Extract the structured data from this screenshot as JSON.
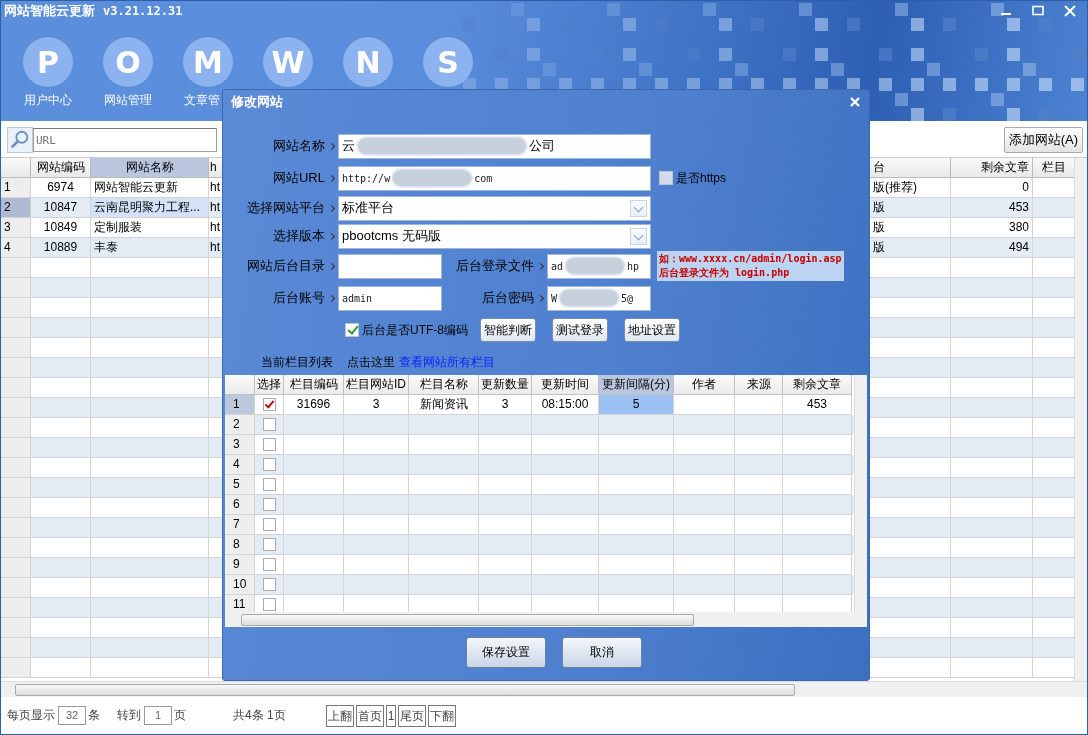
{
  "window": {
    "title": "网站智能云更新",
    "version": "v3.21.12.31"
  },
  "toolbar": [
    {
      "letter": "P",
      "label": "用户中心"
    },
    {
      "letter": "O",
      "label": "网站管理"
    },
    {
      "letter": "M",
      "label": "文章管"
    },
    {
      "letter": "W"
    },
    {
      "letter": "N"
    },
    {
      "letter": "S"
    }
  ],
  "search": {
    "placeholder": "URL"
  },
  "add_button": "添加网站(A)",
  "sites_table": {
    "columns": [
      "网站编码",
      "网站名称",
      "h",
      "台",
      "剩余文章",
      "栏目"
    ],
    "rows": [
      {
        "number": "1",
        "selected": false,
        "cells": [
          "6974",
          "网站智能云更新",
          "ht",
          "版(推荐)",
          "0",
          null
        ]
      },
      {
        "number": "2",
        "selected": true,
        "cells": [
          "10847",
          "云南昆明聚力工程...",
          "ht",
          "版",
          "453",
          null
        ]
      },
      {
        "number": "3",
        "selected": false,
        "cells": [
          "10849",
          "定制服装",
          "ht",
          "版",
          "380",
          null
        ]
      },
      {
        "number": "4",
        "selected": false,
        "cells": [
          "10889",
          "丰泰",
          "ht",
          "版",
          "494",
          null
        ]
      }
    ]
  },
  "pager": {
    "per_page_label": "每页显示",
    "per_page": "32",
    "per_page_unit": "条",
    "goto_label": "转到",
    "goto_page": "1",
    "goto_unit": "页",
    "summary": "共4条 1页",
    "buttons": [
      "上翻",
      "首页",
      "1",
      "尾页",
      "下翻"
    ]
  },
  "dialog": {
    "title": "修改网站",
    "site_name": {
      "label": "网站名称",
      "value_parts": [
        "云",
        "公司"
      ]
    },
    "site_url": {
      "label": "网站URL",
      "value_parts": [
        "http://w",
        "com"
      ]
    },
    "https": {
      "label": "是否https",
      "checked": false
    },
    "platform": {
      "label": "选择网站平台",
      "value": "标准平台"
    },
    "version": {
      "label": "选择版本",
      "value": "pbootcms 无码版"
    },
    "admin_dir": {
      "label": "网站后台目录"
    },
    "login_file": {
      "label": "后台登录文件",
      "value_parts": [
        "ad",
        "hp"
      ]
    },
    "hint": [
      "如：www.xxxx.cn/admin/login.asp",
      "后台登录文件为 login.php"
    ],
    "account": {
      "label": "后台账号",
      "value": "admin"
    },
    "password": {
      "label": "后台密码",
      "value_parts": [
        "W",
        "5@"
      ]
    },
    "utf8": {
      "label": "后台是否UTF-8编码",
      "checked": true
    },
    "action_buttons": [
      "智能判断",
      "测试登录",
      "地址设置"
    ],
    "list_label": "当前栏目列表",
    "click_here": "点击这里",
    "link": "查看网站所有栏目",
    "grid": {
      "columns": [
        {
          "label": "选择",
          "selected": false
        },
        {
          "label": "栏目编码",
          "selected": false
        },
        {
          "label": "栏目网站ID",
          "selected": false
        },
        {
          "label": "栏目名称",
          "selected": false
        },
        {
          "label": "更新数量",
          "selected": false
        },
        {
          "label": "更新时间",
          "selected": false
        },
        {
          "label": "更新间隔(分)",
          "selected": true
        },
        {
          "label": "作者",
          "selected": false
        },
        {
          "label": "来源",
          "selected": false
        },
        {
          "label": "剩余文章",
          "selected": false
        }
      ],
      "rows": [
        {
          "number": "1",
          "checked": true,
          "cells": [
            "31696",
            "3",
            "新闻资讯",
            "3",
            "08:15:00",
            "5",
            null,
            null,
            "453"
          ]
        },
        {
          "number": "2",
          "checked": false
        },
        {
          "number": "3",
          "checked": false
        },
        {
          "number": "4",
          "checked": false
        },
        {
          "number": "5",
          "checked": false
        },
        {
          "number": "6",
          "checked": false
        },
        {
          "number": "7",
          "checked": false
        },
        {
          "number": "8",
          "checked": false
        },
        {
          "number": "9",
          "checked": false
        },
        {
          "number": "10",
          "checked": false
        },
        {
          "number": "11",
          "checked": false
        }
      ]
    },
    "buttons": [
      "保存设置",
      "取消"
    ]
  }
}
